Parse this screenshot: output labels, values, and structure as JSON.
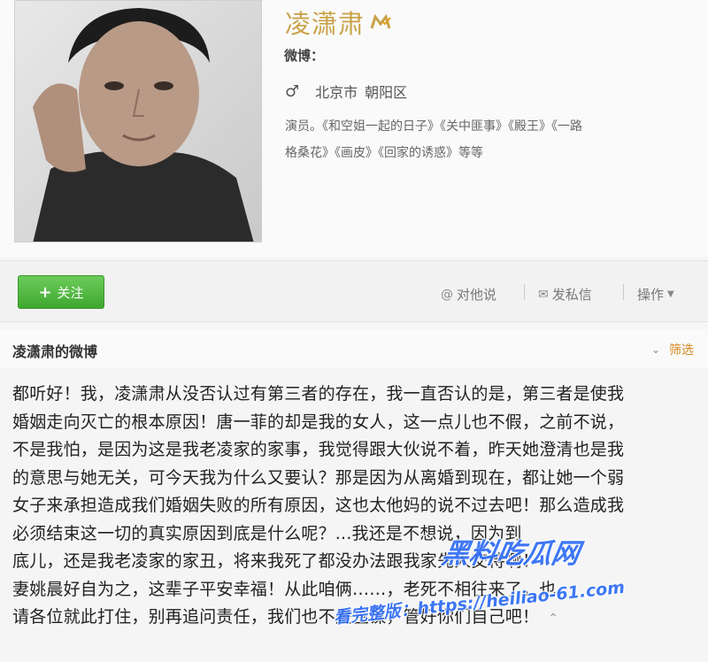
{
  "profile": {
    "name": "凌潇肃",
    "weibo_label": "微博：",
    "city": "北京市",
    "district": "朝阳区",
    "bio_line1": "演员。《和空姐一起的日子》《关中匪事》《殿王》《一路",
    "bio_line2": "格桑花》《画皮》《回家的诱惑》等等"
  },
  "actions": {
    "follow_label": "关注",
    "mention_label": "对他说",
    "message_label": "发私信",
    "more_label": "操作"
  },
  "feed": {
    "title": "凌潇肃的微博",
    "filter_label": "筛选"
  },
  "post": {
    "lines": [
      "都听好！我，凌潇肃从没否认过有第三者的存在，我一直否认的是，第三者是使我",
      "婚姻走向灭亡的根本原因！唐一菲的却是我的女人，这一点儿也不假，之前不说，",
      "不是我怕，是因为这是我老凌家的家事，我觉得跟大伙说不着，昨天她澄清也是我",
      "的意思与她无关，可今天我为什么又要认？那是因为从离婚到现在，都让她一个弱",
      "女子来承担造成我们婚姻失败的所有原因，这也太他妈的说不过去吧！那么造成我",
      "必须结束这一切的真实原因到底是什么呢？...我还是不想说，因为到",
      "底儿，还是我老凌家的家丑，将来我死了都没办法跟我家先人交待啊！",
      "妻姚晨好自为之，这辈子平安幸福！从此咱俩……，老死不相往来了。也",
      "请各位就此打住，别再追问责任，我们也不是主谋，管好你们自己吧！"
    ]
  },
  "watermark": {
    "logo": "黑料吃瓜网",
    "url": "看完整版：https://heiliao-61.com"
  },
  "colors": {
    "name_gold": "#c9a34a",
    "follow_green": "#3fa82f",
    "filter_orange": "#d38a1e",
    "watermark_blue": "#2f6df6"
  }
}
